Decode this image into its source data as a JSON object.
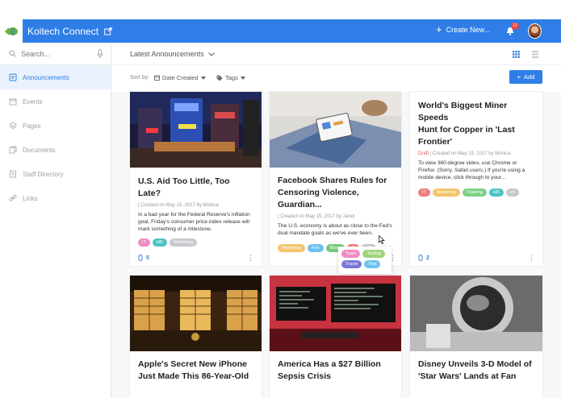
{
  "header": {
    "app_title": "Koitech Connect",
    "create_label": "Create New...",
    "notification_count": "12",
    "colors": {
      "brand": "#2f7ee8"
    }
  },
  "sidebar": {
    "search_placeholder": "Search...",
    "items": [
      {
        "label": "Announcements",
        "icon": "megaphone-icon",
        "active": true
      },
      {
        "label": "Events",
        "icon": "calendar-icon"
      },
      {
        "label": "Pages",
        "icon": "layers-icon"
      },
      {
        "label": "Documents",
        "icon": "documents-icon"
      },
      {
        "label": "Staff Directory",
        "icon": "directory-icon"
      },
      {
        "label": "Links",
        "icon": "link-icon"
      }
    ]
  },
  "main": {
    "view_select": "Latest Announcements",
    "sort_by_label": "Sort by:",
    "sort_value": "Date Created",
    "tags_label": "Tags",
    "add_label": "Add"
  },
  "cards": [
    {
      "title_line1": "U.S. Aid Too Little, Too Late?",
      "meta": "Created on May 15, 2017 by Monica",
      "excerpt": "In a bad year for the Federal Reserve's inflation goal, Friday's consumer price index release will mark something of a milestone.",
      "tags": [
        {
          "label": "IT",
          "color": "#f08bc3"
        },
        {
          "label": "HR",
          "color": "#4ec3c3"
        },
        {
          "label": "Marketing",
          "color": "#c7c9cc"
        }
      ],
      "likes": "5"
    },
    {
      "title_line1": "Facebook Shares Rules for",
      "title_line2": "Censoring Violence, Guardian...",
      "meta": "Created on May 15, 2017 by Jared",
      "excerpt": "The U.S. economy is about as close to the Fed's dual mandate goals as we've ever been.",
      "tags": [
        {
          "label": "Marketing",
          "color": "#f3c46b"
        },
        {
          "label": "Fun",
          "color": "#6fc2ee"
        },
        {
          "label": "Blogs",
          "color": "#77c97a"
        },
        {
          "label": "IT",
          "color": "#ef7c7c"
        },
        {
          "label": "HR",
          "color": "#c7c9cc"
        }
      ],
      "popover_tags": [
        {
          "label": "Team",
          "color": "#f08bc3"
        },
        {
          "label": "Testing",
          "color": "#9fd47b"
        },
        {
          "label": "Travel",
          "color": "#7a78d6"
        },
        {
          "label": "Test",
          "color": "#6fc2ee"
        }
      ]
    },
    {
      "title_line1": "World's Biggest Miner Speeds",
      "title_line2": "Hunt for Copper in 'Last",
      "title_line3": "Frontier'",
      "draft": "Draft",
      "meta": "Created on May 15, 2017 by Monica",
      "excerpt": "To view 360-degree video, use Chrome or Firefox. (Sorry, Safari users.) If you're using a mobile device, click through to your...",
      "tags": [
        {
          "label": "IT",
          "color": "#ef7c7c"
        },
        {
          "label": "Marketing",
          "color": "#f3c46b"
        },
        {
          "label": "Training",
          "color": "#7fcf86"
        },
        {
          "label": "HR",
          "color": "#4ec3c3"
        },
        {
          "label": "+5",
          "color": "#c7c9cc"
        }
      ],
      "likes": "2"
    },
    {
      "title_line1": "Apple's Secret New iPhone",
      "title_line2": "Just Made This 86-Year-Old"
    },
    {
      "title_line1": "America Has a $27 Billion",
      "title_line2": "Sepsis Crisis"
    },
    {
      "title_line1": "Disney Unveils 3-D Model of",
      "title_line2": "'Star Wars' Lands at Fan"
    }
  ]
}
